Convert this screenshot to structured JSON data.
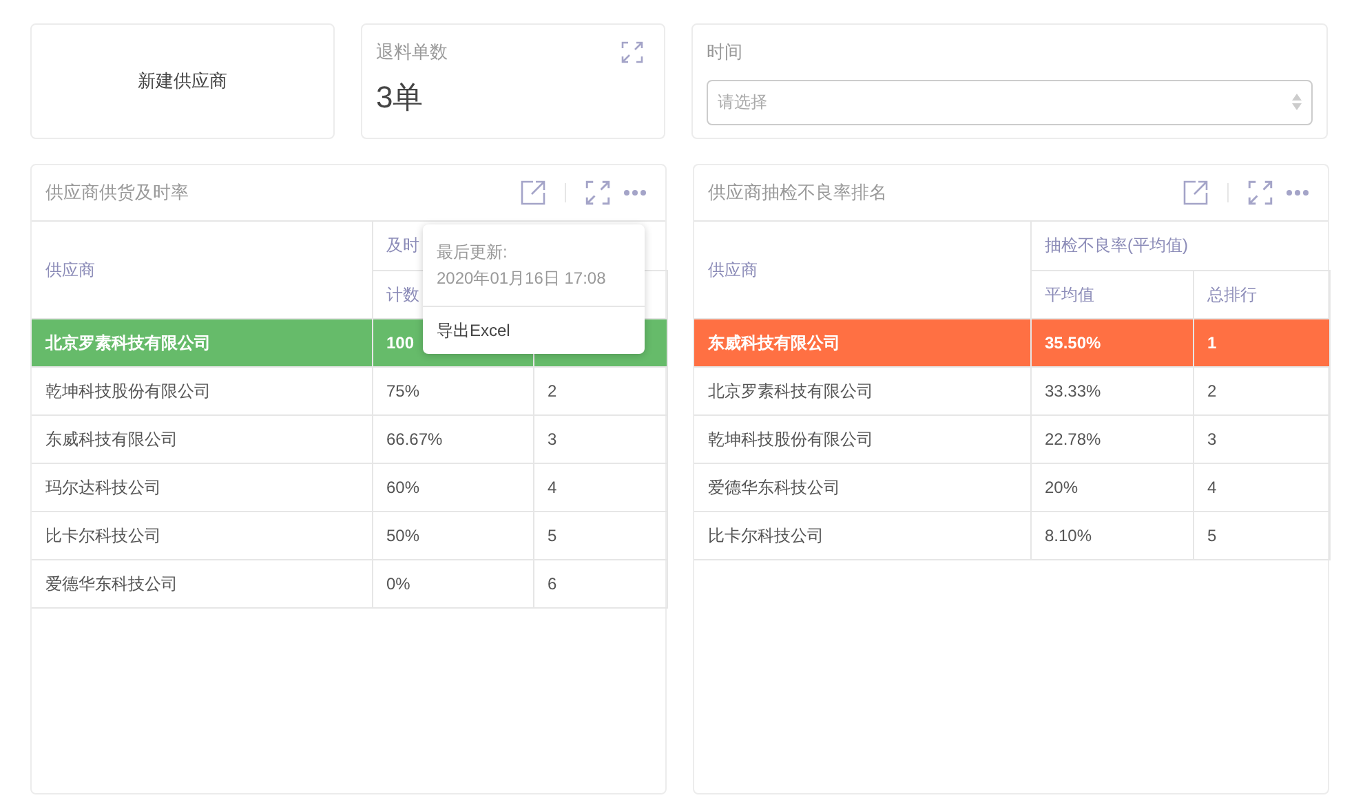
{
  "new_supplier": {
    "label": "新建供应商"
  },
  "return_orders": {
    "title": "退料单数",
    "value": "3单"
  },
  "time_filter": {
    "label": "时间",
    "placeholder": "请选择"
  },
  "panels": [
    {
      "title": "供应商供货及时率",
      "group_header": "及时",
      "columns": [
        "供应商",
        "计数"
      ],
      "rows": [
        {
          "cells": [
            "北京罗素科技有限公司",
            "100"
          ],
          "color": "#66bb6a"
        },
        {
          "cells": [
            "乾坤科技股份有限公司",
            "75%",
            "2"
          ]
        },
        {
          "cells": [
            "东威科技有限公司",
            "66.67%",
            "3"
          ]
        },
        {
          "cells": [
            "玛尔达科技公司",
            "60%",
            "4"
          ]
        },
        {
          "cells": [
            "比卡尔科技公司",
            "50%",
            "5"
          ]
        },
        {
          "cells": [
            "爱德华东科技公司",
            "0%",
            "6"
          ]
        }
      ],
      "menu": {
        "updated_label": "最后更新:",
        "updated_time": "2020年01月16日 17:08",
        "export": "导出Excel"
      }
    },
    {
      "title": "供应商抽检不良率排名",
      "group_header": "抽检不良率(平均值)",
      "columns": [
        "供应商",
        "平均值",
        "总排行"
      ],
      "rows": [
        {
          "cells": [
            "东威科技有限公司",
            "35.50%",
            "1"
          ],
          "color": "#ff7043"
        },
        {
          "cells": [
            "北京罗素科技有限公司",
            "33.33%",
            "2"
          ]
        },
        {
          "cells": [
            "乾坤科技股份有限公司",
            "22.78%",
            "3"
          ]
        },
        {
          "cells": [
            "爱德华东科技公司",
            "20%",
            "4"
          ]
        },
        {
          "cells": [
            "比卡尔科技公司",
            "8.10%",
            "5"
          ]
        }
      ]
    }
  ]
}
